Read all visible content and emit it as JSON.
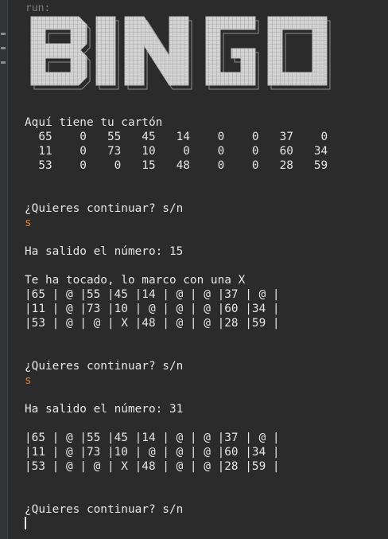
{
  "run_label": "run:",
  "banner_text": "BINGO",
  "console_lines": [
    {
      "text": "Aquí tiene tu cartón"
    },
    {
      "text": "  65    0   55   45   14    0    0   37    0"
    },
    {
      "text": "  11    0   73   10    0    0    0   60   34"
    },
    {
      "text": "  53    0    0   15   48    0    0   28   59"
    },
    {
      "text": ""
    },
    {
      "text": ""
    },
    {
      "text": "¿Quieres continuar? s/n"
    },
    {
      "text": "s",
      "style": "input"
    },
    {
      "text": ""
    },
    {
      "text": "Ha salido el número: 15"
    },
    {
      "text": ""
    },
    {
      "text": "Te ha tocado, lo marco con una X"
    },
    {
      "text": "|65 | @ |55 |45 |14 | @ | @ |37 | @ |"
    },
    {
      "text": "|11 | @ |73 |10 | @ | @ | @ |60 |34 |"
    },
    {
      "text": "|53 | @ | @ | X |48 | @ | @ |28 |59 |"
    },
    {
      "text": ""
    },
    {
      "text": ""
    },
    {
      "text": "¿Quieres continuar? s/n"
    },
    {
      "text": "s",
      "style": "input"
    },
    {
      "text": ""
    },
    {
      "text": "Ha salido el número: 31"
    },
    {
      "text": ""
    },
    {
      "text": "|65 | @ |55 |45 |14 | @ | @ |37 | @ |"
    },
    {
      "text": "|11 | @ |73 |10 | @ | @ | @ |60 |34 |"
    },
    {
      "text": "|53 | @ | @ | X |48 | @ | @ |28 |59 |"
    },
    {
      "text": ""
    },
    {
      "text": ""
    },
    {
      "text": "¿Quieres continuar? s/n"
    },
    {
      "text": "",
      "style": "cursor"
    }
  ],
  "colors": {
    "background": "#2b2b2b",
    "text": "#e6e6e6",
    "input": "#d97d3a",
    "banner_fill": "#d4d4d4",
    "banner_outline": "#bdbdbd"
  }
}
